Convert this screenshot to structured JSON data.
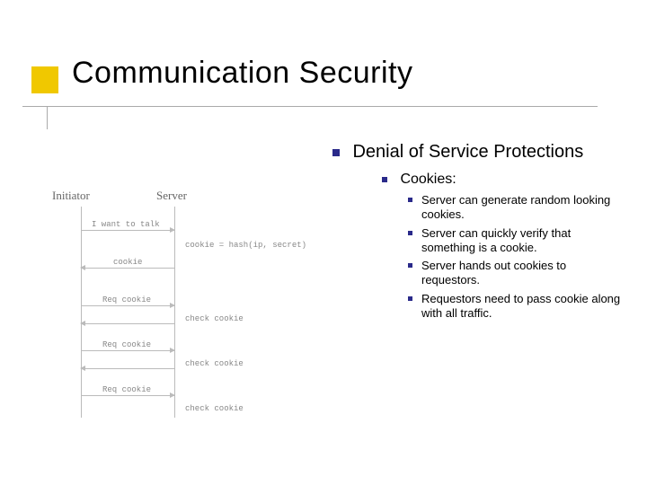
{
  "title": "Communication Security",
  "diagram": {
    "left_role": "Initiator",
    "right_role": "Server",
    "messages": {
      "m1": "I want to talk",
      "m2": "cookie = hash(ip, secret)",
      "m3": "cookie",
      "m4": "Req cookie",
      "m5": "check cookie",
      "m6": "Req cookie",
      "m7": "check cookie",
      "m8": "Req cookie",
      "m9": "check cookie"
    }
  },
  "outline": {
    "l1": "Denial of Service Protections",
    "l2": "Cookies:",
    "l3": [
      "Server can generate random looking cookies.",
      "Server can quickly verify that something is a cookie.",
      "Server hands out cookies to requestors.",
      "Requestors need to pass cookie along with all traffic."
    ]
  }
}
